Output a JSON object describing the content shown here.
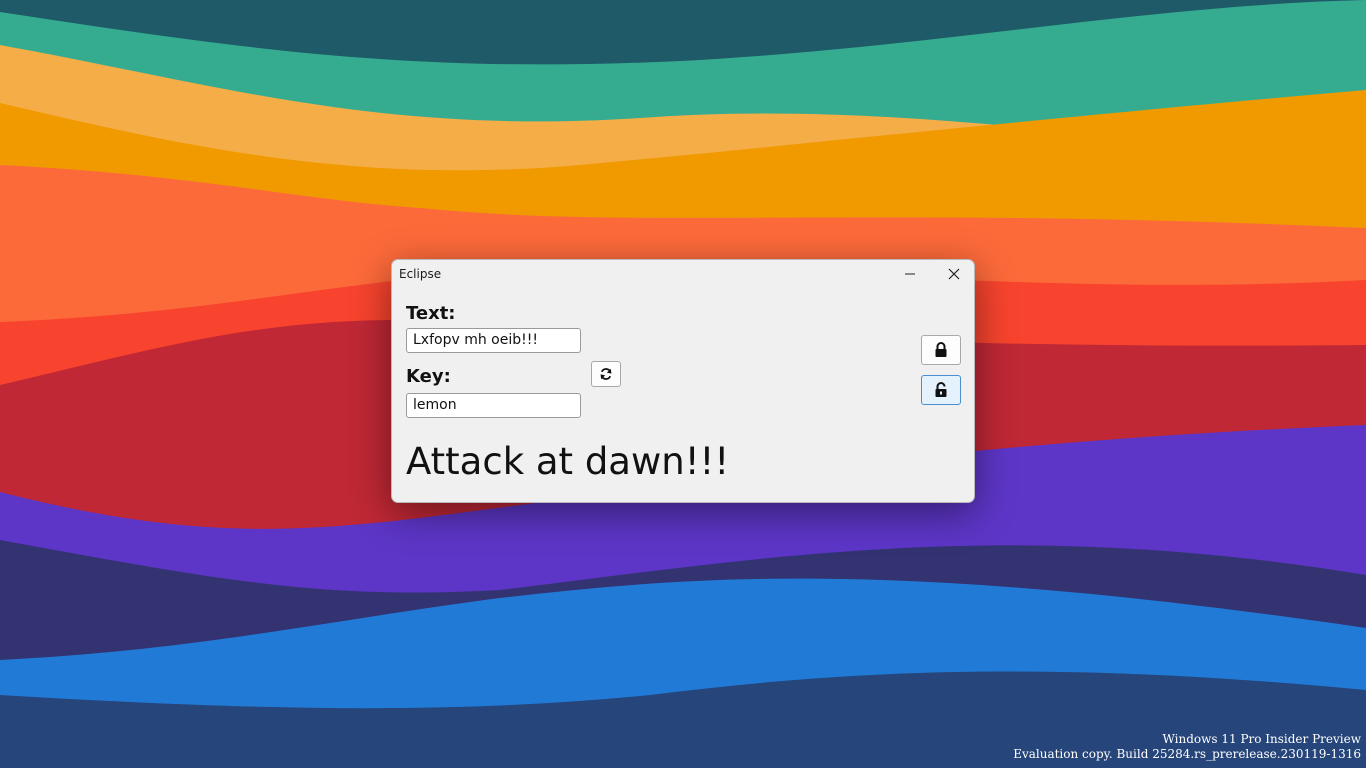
{
  "desktop": {
    "wallpaper_colors": [
      "#1f5a69",
      "#35ac90",
      "#f5ad48",
      "#f09a00",
      "#fd6a3a",
      "#f8442e",
      "#c02835",
      "#5d36c8",
      "#333372",
      "#217bd6",
      "#26457a"
    ],
    "watermark": {
      "line1": "Windows 11 Pro Insider Preview",
      "line2": "Evaluation copy. Build 25284.rs_prerelease.230119-1316"
    }
  },
  "window": {
    "title": "Eclipse",
    "minimize_icon": "minimize-icon",
    "close_icon": "close-icon",
    "text_label": "Text:",
    "text_value": "Lxfopv mh oeib!!!",
    "key_label": "Key:",
    "key_value": "lemon",
    "refresh_icon": "refresh-icon",
    "lock_icon": "lock-icon",
    "unlock_icon": "unlock-icon",
    "result": "Attack at dawn!!!"
  }
}
